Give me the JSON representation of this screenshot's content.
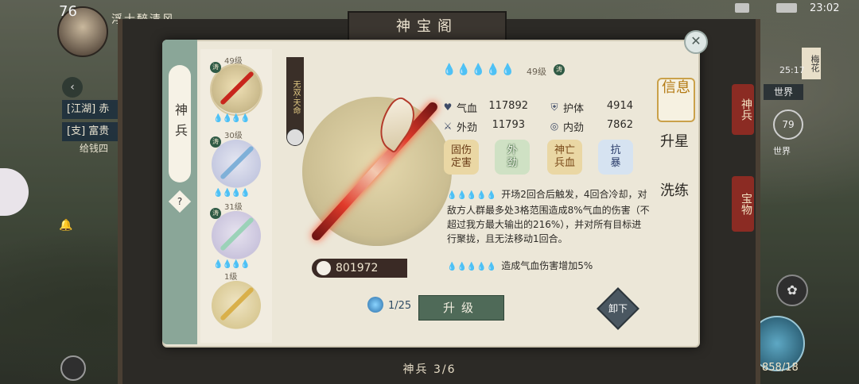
{
  "hud": {
    "level": "76",
    "player_name": "浮士醉清风",
    "clock": "23:02"
  },
  "background_ui": {
    "side_tags": [
      "[江湖] 赤",
      "[支] 富贵"
    ],
    "gold_label": "给钱四",
    "right_time": "25:17",
    "right_world": "世界",
    "right_pin": "梅花",
    "right_moon": "79",
    "right_round": "世界",
    "side_tab_top": "神兵",
    "side_tab_bottom": "宝物",
    "meditate_value": "858/18"
  },
  "frame": {
    "title": "神宝阁",
    "bottom_label": "神兵 3/6"
  },
  "category": {
    "tab_label": "神兵",
    "help_icon": "?"
  },
  "weapon_list": [
    {
      "level": "49级",
      "badge": "涛",
      "drops": "💧💧💧💧",
      "color": "#c8261c"
    },
    {
      "level": "30级",
      "badge": "涛",
      "drops": "💧💧💧💧",
      "color": "#7fb0d8"
    },
    {
      "level": "31级",
      "badge": "涛",
      "drops": "💧💧💧💧",
      "color": "#9bd2b8"
    },
    {
      "level": "1级",
      "badge": "",
      "drops": "",
      "color": "#d9b04a"
    }
  ],
  "weapon": {
    "banner": "无双·天命",
    "power": "801972",
    "stars": "💧💧💧💧💧",
    "level": "49级",
    "level_badge": "涛"
  },
  "stats": [
    {
      "icon": "♥",
      "name": "气血",
      "value": "117892"
    },
    {
      "icon": "⛨",
      "name": "护体",
      "value": "4914"
    },
    {
      "icon": "⚔",
      "name": "外劲",
      "value": "11793"
    },
    {
      "icon": "◎",
      "name": "内劲",
      "value": "7862"
    }
  ],
  "tags": [
    {
      "line1": "固伤",
      "line2": "定害"
    },
    {
      "line1": "外",
      "line2": "劲"
    },
    {
      "line1": "神亡",
      "line2": "兵血"
    },
    {
      "line1": "抗",
      "line2": "暴"
    }
  ],
  "skills": [
    {
      "drops_on": "💧",
      "drops_off": "💧💧💧💧",
      "text": "开场2回合后触发，4回合冷却，对敌方人群最多处3格范围造成8%气血的伤害（不超过我方最大输出的216%），并对所有目标进行聚拢，且无法移动1回合。"
    },
    {
      "drops_on": "💧💧",
      "drops_off": "💧💧💧",
      "text": "造成气血伤害增加5%"
    }
  ],
  "right_nav": {
    "info": "信息",
    "star": "升星",
    "wash": "洗练"
  },
  "bottom": {
    "upgrade_count": "1/25",
    "upgrade_label": "升级",
    "unequip_label": "卸下"
  }
}
